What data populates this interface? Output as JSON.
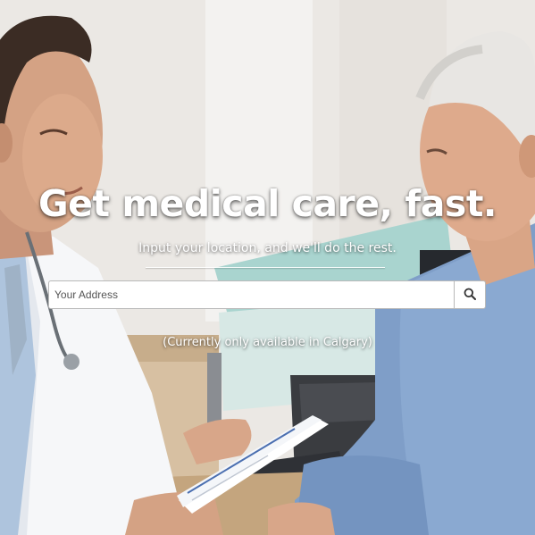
{
  "hero": {
    "headline": "Get medical care, fast.",
    "subtitle": "Input your location, and we'll do the rest.",
    "search": {
      "placeholder": "Your Address",
      "value": "",
      "button_icon": "search-icon"
    },
    "availability_note": "(Currently only available in Calgary)"
  }
}
